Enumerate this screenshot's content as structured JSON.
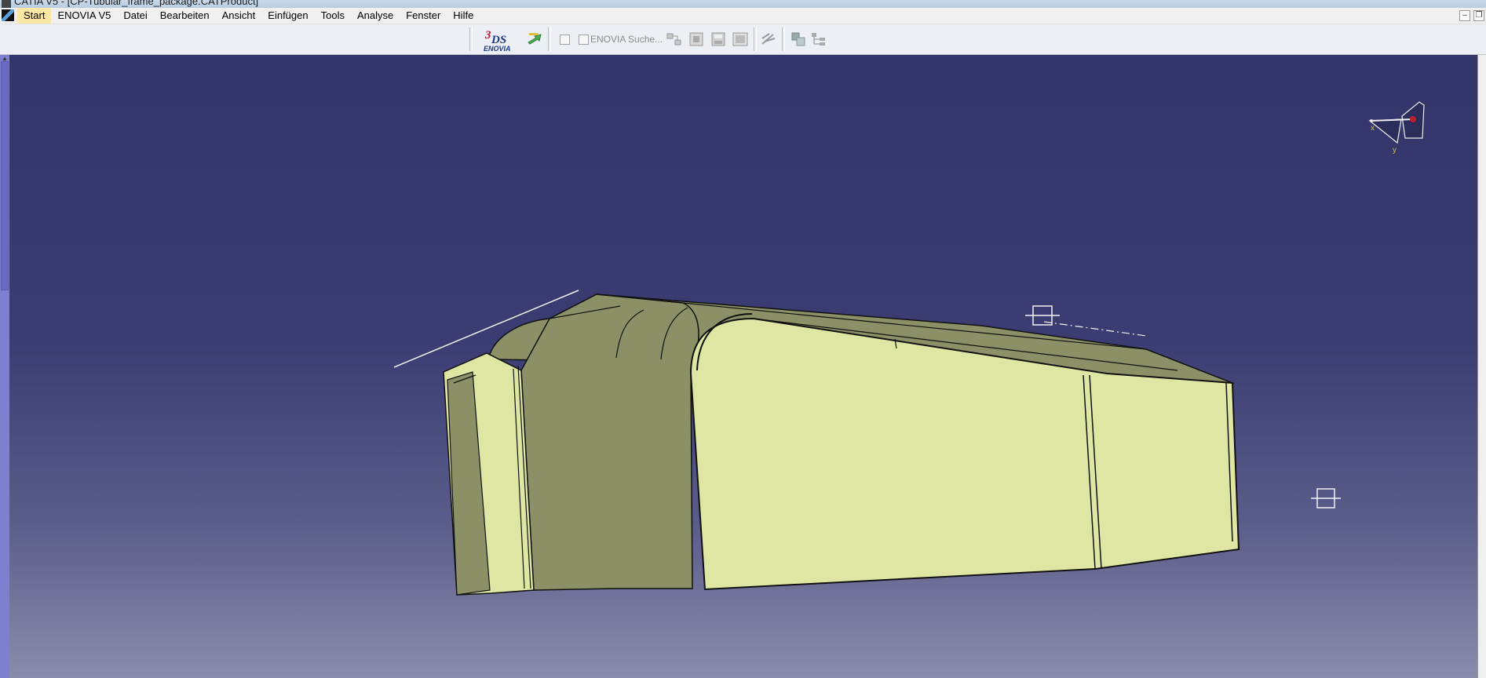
{
  "window": {
    "title": "CATIA V5 - [CP-Tubular_frame_package.CATProduct]"
  },
  "menu": {
    "items": [
      "Start",
      "ENOVIA V5",
      "Datei",
      "Bearbeiten",
      "Ansicht",
      "Einfügen",
      "Tools",
      "Analyse",
      "Fenster",
      "Hilfe"
    ]
  },
  "toolbar": {
    "logo_text": "ENOVIA",
    "search_label": "ENOVIA Suche..."
  },
  "compass": {
    "x_label": "x",
    "y_label": "y"
  },
  "colors": {
    "viewport_top": "#32346a",
    "viewport_bottom": "#8a8cac",
    "part_light": "#dfe6a4",
    "part_dark": "#8b9066",
    "menu_active": "#fbe7a4"
  }
}
